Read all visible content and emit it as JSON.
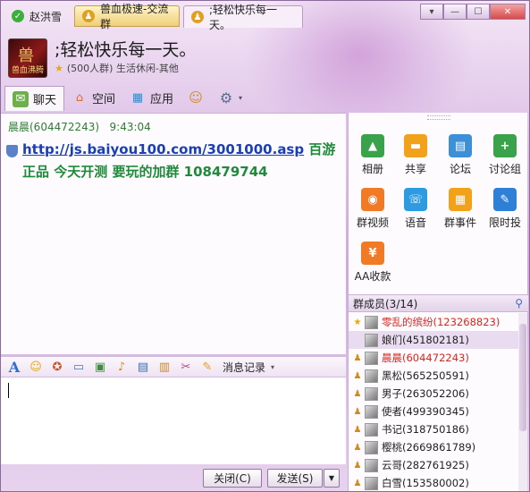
{
  "tabs": [
    {
      "label": "赵洪雪"
    },
    {
      "label": "兽血极速-交流群"
    },
    {
      "label": ";轻松快乐每一天。"
    }
  ],
  "window_controls": {
    "menu": "▾",
    "minimize": "—",
    "maximize": "☐",
    "close": "✕"
  },
  "group": {
    "avatar_text": "兽血沸腾",
    "title": ";轻松快乐每一天。",
    "subtitle": "(500人群) 生活休闲-其他"
  },
  "nav": [
    {
      "label": "聊天",
      "icon": "chat-icon"
    },
    {
      "label": "空间",
      "icon": "house-icon"
    },
    {
      "label": "应用",
      "icon": "apps-grid-icon"
    },
    {
      "label": "",
      "icon": "add-member-icon"
    },
    {
      "label": "",
      "icon": "gear-icon"
    }
  ],
  "message": {
    "sender": "晨晨(604472243)",
    "time": "9:43:04",
    "link": "http://js.baiyou100.com/3001000.asp",
    "text": " 百游正品 今天开测 要玩的加群 108479744"
  },
  "toolbar": {
    "history_label": "消息记录"
  },
  "buttons": {
    "close": "关闭(C)",
    "send": "发送(S)"
  },
  "apps": [
    {
      "label": "相册",
      "color": "#3aa24a",
      "icon": "photo-album-icon"
    },
    {
      "label": "共享",
      "color": "#f2a11b",
      "icon": "folder-share-icon"
    },
    {
      "label": "论坛",
      "color": "#3d8fd8",
      "icon": "forum-icon"
    },
    {
      "label": "讨论组",
      "color": "#3aa24a",
      "icon": "discussion-group-icon"
    },
    {
      "label": "群视频",
      "color": "#f07a25",
      "icon": "group-video-icon"
    },
    {
      "label": "语音",
      "color": "#2e9be0",
      "icon": "voice-icon"
    },
    {
      "label": "群事件",
      "color": "#f2a11b",
      "icon": "group-event-icon"
    },
    {
      "label": "限时投",
      "color": "#2e7fd6",
      "icon": "timed-vote-icon"
    },
    {
      "label": "AA收款",
      "color": "#f07a25",
      "icon": "aa-payment-icon"
    }
  ],
  "members": {
    "header": "群成员(3/14)",
    "list": [
      {
        "name": "零乱的缤纷(123268823)",
        "red": true,
        "badge": "owner"
      },
      {
        "name": "娘们(451802181)",
        "red": false,
        "badge": ""
      },
      {
        "name": "晨晨(604472243)",
        "red": true,
        "badge": "user"
      },
      {
        "name": "黑松(565250591)",
        "red": false,
        "badge": "user"
      },
      {
        "name": "男子(263052206)",
        "red": false,
        "badge": "user"
      },
      {
        "name": "使者(499390345)",
        "red": false,
        "badge": "user"
      },
      {
        "name": "书记(318750186)",
        "red": false,
        "badge": "user"
      },
      {
        "name": "樱桃(2669861789)",
        "red": false,
        "badge": "user"
      },
      {
        "name": "云哥(282761925)",
        "red": false,
        "badge": "user"
      },
      {
        "name": "白雪(153580002)",
        "red": false,
        "badge": "user"
      }
    ]
  }
}
